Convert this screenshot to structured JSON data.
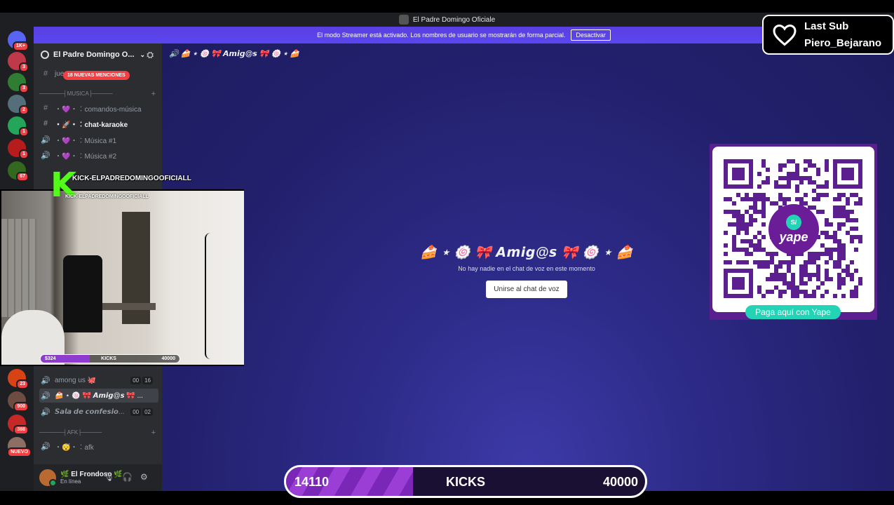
{
  "window": {
    "title": "El Padre Domingo Oficiale"
  },
  "banner": {
    "message": "El modo Streamer está activado. Los nombres de usuario se mostrarán de forma parcial.",
    "button_label": "Desactivar"
  },
  "server_rail": {
    "items": [
      {
        "name": "dm-home",
        "badge": "1K+",
        "color": "#5865f2"
      },
      {
        "name": "server-1",
        "badge": "3",
        "color": "#c0394b"
      },
      {
        "name": "server-2",
        "badge": "3",
        "color": "#2e7d32"
      },
      {
        "name": "server-3",
        "badge": "2",
        "color": "#546e7a"
      },
      {
        "name": "server-4",
        "badge": "1",
        "color": "#23a55a"
      },
      {
        "name": "server-5",
        "badge": "1",
        "color": "#b71c1c"
      },
      {
        "name": "server-6",
        "badge": "67",
        "color": "#33691e"
      },
      {
        "name": "server-7",
        "badge": "23",
        "color": "#d84315"
      },
      {
        "name": "server-8",
        "badge": "900",
        "color": "#6d4c41"
      },
      {
        "name": "server-9",
        "badge": "388",
        "color": "#c62828"
      },
      {
        "name": "server-10",
        "badge": "NUEVO",
        "color": "#8d6e63"
      }
    ]
  },
  "sidebar": {
    "server_name": "El Padre Domingo O...",
    "mentions_pill": "18 NUEVAS MENCIONES",
    "channels": {
      "jue": "jue",
      "cat_musica": "──────┤MUSICA├─────",
      "comandos": "・💜・︰comandos-música",
      "karaoke": "・🚀・︰chat-karaoke",
      "musica1": "・💜・︰Música #1",
      "musica2": "・💜・︰Música #2",
      "among": "among us 🐙",
      "among_counts": [
        "00",
        "16"
      ],
      "amigos": "🍰 ⋆ 🍥 🎀 𝘼𝙢𝙞𝙜@𝙨 🎀 ...",
      "sala": "𝙎𝙖𝙡𝙖 𝙙𝙚 𝙘𝙤𝙣𝙛𝙚𝙨𝙞𝙤...",
      "sala_counts": [
        "00",
        "02"
      ],
      "cat_afk": "──────┤AFK├─────",
      "afk": "・😴・︰afk"
    }
  },
  "user_panel": {
    "name": "🌿 El Frondoso 🌿",
    "status": "En línea"
  },
  "main": {
    "channel_header": "🍰 ⋆ 🍥 🎀 𝘼𝙢𝙞𝙜@𝙨 🎀 🍥 ⋆ 🍰",
    "voice_title": "🍰 ⋆ 🍥 🎀 𝘼𝙢𝙞𝙜@𝙨 🎀 🍥 ⋆ 🍰",
    "voice_subtitle": "No hay nadie en el chat de voz en este momento",
    "join_button": "Unirse al chat de voz"
  },
  "qr": {
    "caption": "Paga aquí con Yape",
    "logo_text": "yape",
    "logo_badge": "S/"
  },
  "last_sub": {
    "line1": "Last Sub",
    "line2": "Piero_Bejarano"
  },
  "kick_overlay": {
    "line1": "KICK-ELPADREDOMINGOOFICIALL",
    "line2": "KICK-ELPADREDOMINGOOFICIALL"
  },
  "webcam_bar": {
    "left": "$324",
    "label": "KICKS",
    "right": "40000"
  },
  "kicks_bar": {
    "current": "14110",
    "label": "KICKS",
    "goal": "40000",
    "progress": 0.3528
  },
  "colors": {
    "accent": "#5865f2",
    "kick_green": "#53fc18",
    "yape_teal": "#22d3b5",
    "yape_purple": "#6a1d97"
  }
}
